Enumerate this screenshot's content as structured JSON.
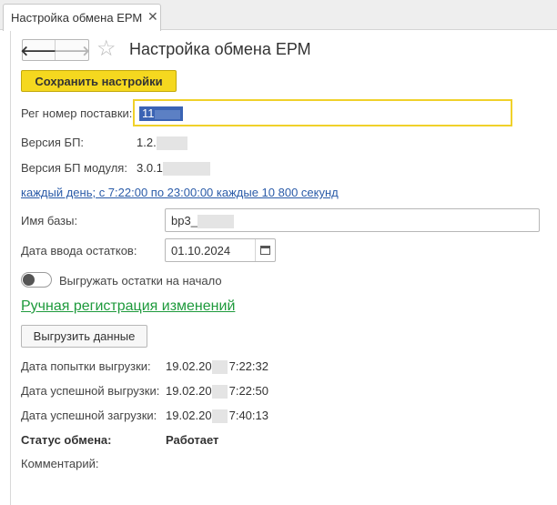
{
  "tab": {
    "title": "Настройка обмена ЕРМ",
    "close": "✕"
  },
  "nav": {
    "back": "🡐",
    "forward": "🡒",
    "star": "☆"
  },
  "page_title": "Настройка обмена ЕРМ",
  "buttons": {
    "save": "Сохранить настройки",
    "export": "Выгрузить данные"
  },
  "form": {
    "reg_number": {
      "label": "Рег номер поставки:",
      "value": "11"
    },
    "bp_version": {
      "label": "Версия БП:",
      "value": "1.2."
    },
    "bp_module_version": {
      "label": "Версия БП модуля:",
      "value": "3.0.1"
    },
    "schedule": "каждый день; с 7:22:00 по 23:00:00 каждые 10 800 секунд",
    "db_name": {
      "label": "Имя базы:",
      "value": "bp3_"
    },
    "balance_date": {
      "label": "Дата ввода остатков:",
      "value": "01.10.2024"
    },
    "export_balances": {
      "label": "Выгружать остатки на начало",
      "checked": false
    },
    "manual_registration": "Ручная регистрация изменений"
  },
  "status": {
    "last_attempt": {
      "label": "Дата попытки выгрузки:",
      "date": "19.02.20",
      "time": "7:22:32"
    },
    "last_export": {
      "label": "Дата успешной выгрузки:",
      "date": "19.02.20",
      "time": "7:22:50"
    },
    "last_import": {
      "label": "Дата успешной загрузки:",
      "date": "19.02.20",
      "time": "7:40:13"
    },
    "exchange_status": {
      "label": "Статус обмена:",
      "value": "Работает"
    },
    "comment": {
      "label": "Комментарий:",
      "value": ""
    }
  },
  "colors": {
    "accent": "#f5d81f",
    "link": "#2a5ba8",
    "green_link": "#1e9a3c",
    "selection": "#3a63b4"
  }
}
